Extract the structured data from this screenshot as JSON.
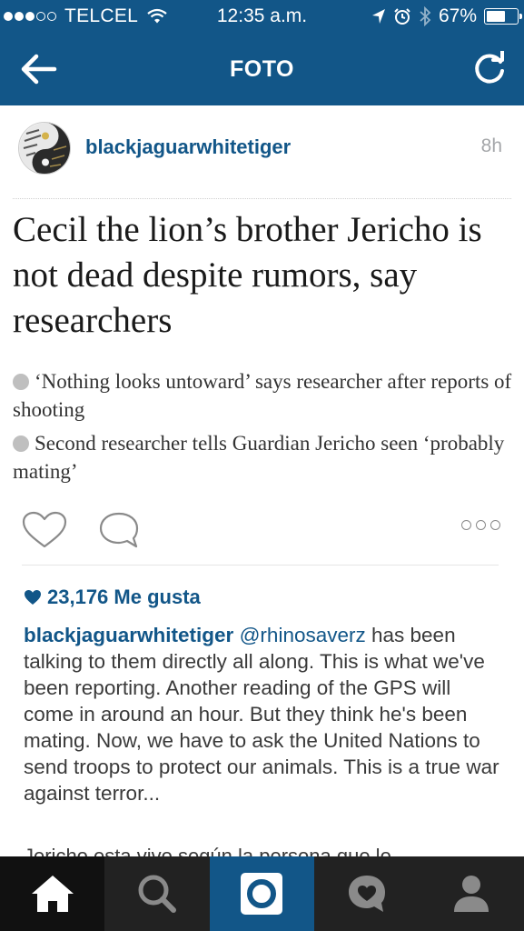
{
  "status_bar": {
    "carrier": "TELCEL",
    "time": "12:35 a.m.",
    "battery": "67%",
    "battery_level": 0.67,
    "signal_bars": 3,
    "signal_max": 5
  },
  "nav": {
    "title": "FOTO"
  },
  "post": {
    "username": "blackjaguarwhitetiger",
    "time_ago": "8h",
    "headline": "Cecil the lion’s brother Jericho is not dead despite rumors, say researchers",
    "bullets": [
      "‘Nothing looks untoward’ says researcher after reports of shooting",
      "Second researcher tells Guardian Jericho seen ‘probably mating’"
    ],
    "likes": "23,176 Me gusta",
    "caption": {
      "user": "blackjaguarwhitetiger",
      "mention": "@rhinosaverz",
      "text": " has been talking to them directly all along. This is what we've been reporting. Another reading of the GPS will come in around an hour. But they think he's been mating. Now, we have to ask the United Nations to send troops to protect our animals. This is a true war against terror..."
    },
    "next_caption": "Jericho esta vivo según la persona que lo"
  },
  "colors": {
    "brand_blue": "#125688",
    "tabbar": "#222222"
  },
  "tabs": [
    {
      "icon": "home-icon"
    },
    {
      "icon": "search-icon"
    },
    {
      "icon": "camera-icon"
    },
    {
      "icon": "activity-icon"
    },
    {
      "icon": "profile-icon"
    }
  ]
}
